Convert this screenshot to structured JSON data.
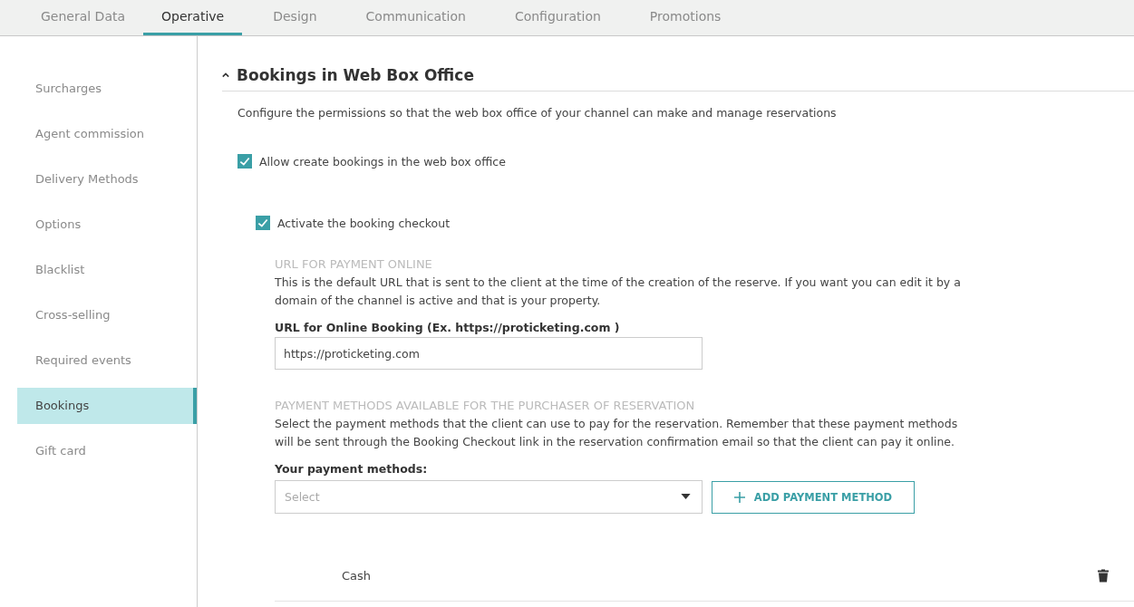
{
  "tabs": [
    {
      "label": "General Data",
      "selected": false
    },
    {
      "label": "Operative",
      "selected": true
    },
    {
      "label": "Design",
      "selected": false
    },
    {
      "label": "Communication",
      "selected": false
    },
    {
      "label": "Configuration",
      "selected": false
    },
    {
      "label": "Promotions",
      "selected": false
    }
  ],
  "sidebar": {
    "items": [
      {
        "label": "Surcharges",
        "selected": false
      },
      {
        "label": "Agent commission",
        "selected": false
      },
      {
        "label": "Delivery Methods",
        "selected": false
      },
      {
        "label": "Options",
        "selected": false
      },
      {
        "label": "Blacklist",
        "selected": false
      },
      {
        "label": "Cross-selling",
        "selected": false
      },
      {
        "label": "Required events",
        "selected": false
      },
      {
        "label": "Bookings",
        "selected": true
      },
      {
        "label": "Gift card",
        "selected": false
      }
    ]
  },
  "section": {
    "title": "Bookings in Web Box Office",
    "expanded": true,
    "description": "Configure the permissions so that the web box office of your channel can make and manage reservations",
    "allow_bookings": {
      "label": "Allow create bookings in the web box office",
      "checked": true
    },
    "activate_checkout": {
      "label": "Activate the booking checkout",
      "checked": true
    },
    "url_block": {
      "heading": "URL FOR PAYMENT ONLINE",
      "description": "This is the default URL that is sent to the client at the time of the creation of the reserve. If you want you can edit it by a domain of the channel is active and that is your property.",
      "field_label": "URL for Online Booking (Ex. https://proticketing.com )",
      "field_value": "https://proticketing.com"
    },
    "payment_block": {
      "heading": "PAYMENT METHODS AVAILABLE FOR THE PURCHASER OF RESERVATION",
      "description": "Select the payment methods that the client can use to pay for the reservation. Remember that these payment methods will be sent through the Booking Checkout link in the reservation confirmation email so that the client can pay it online.",
      "field_label": "Your payment methods:",
      "select_placeholder": "Select",
      "add_button": "ADD PAYMENT METHOD",
      "methods": [
        {
          "name": "Cash"
        }
      ]
    }
  }
}
